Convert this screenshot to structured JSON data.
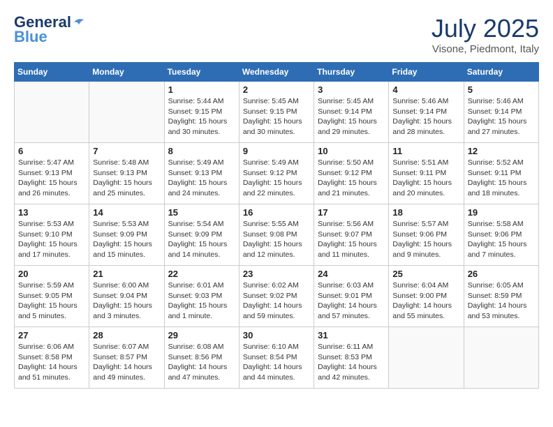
{
  "header": {
    "logo_line1": "General",
    "logo_line2": "Blue",
    "month_title": "July 2025",
    "location": "Visone, Piedmont, Italy"
  },
  "weekdays": [
    "Sunday",
    "Monday",
    "Tuesday",
    "Wednesday",
    "Thursday",
    "Friday",
    "Saturday"
  ],
  "weeks": [
    [
      {
        "day": "",
        "info": ""
      },
      {
        "day": "",
        "info": ""
      },
      {
        "day": "1",
        "info": "Sunrise: 5:44 AM\nSunset: 9:15 PM\nDaylight: 15 hours\nand 30 minutes."
      },
      {
        "day": "2",
        "info": "Sunrise: 5:45 AM\nSunset: 9:15 PM\nDaylight: 15 hours\nand 30 minutes."
      },
      {
        "day": "3",
        "info": "Sunrise: 5:45 AM\nSunset: 9:14 PM\nDaylight: 15 hours\nand 29 minutes."
      },
      {
        "day": "4",
        "info": "Sunrise: 5:46 AM\nSunset: 9:14 PM\nDaylight: 15 hours\nand 28 minutes."
      },
      {
        "day": "5",
        "info": "Sunrise: 5:46 AM\nSunset: 9:14 PM\nDaylight: 15 hours\nand 27 minutes."
      }
    ],
    [
      {
        "day": "6",
        "info": "Sunrise: 5:47 AM\nSunset: 9:13 PM\nDaylight: 15 hours\nand 26 minutes."
      },
      {
        "day": "7",
        "info": "Sunrise: 5:48 AM\nSunset: 9:13 PM\nDaylight: 15 hours\nand 25 minutes."
      },
      {
        "day": "8",
        "info": "Sunrise: 5:49 AM\nSunset: 9:13 PM\nDaylight: 15 hours\nand 24 minutes."
      },
      {
        "day": "9",
        "info": "Sunrise: 5:49 AM\nSunset: 9:12 PM\nDaylight: 15 hours\nand 22 minutes."
      },
      {
        "day": "10",
        "info": "Sunrise: 5:50 AM\nSunset: 9:12 PM\nDaylight: 15 hours\nand 21 minutes."
      },
      {
        "day": "11",
        "info": "Sunrise: 5:51 AM\nSunset: 9:11 PM\nDaylight: 15 hours\nand 20 minutes."
      },
      {
        "day": "12",
        "info": "Sunrise: 5:52 AM\nSunset: 9:11 PM\nDaylight: 15 hours\nand 18 minutes."
      }
    ],
    [
      {
        "day": "13",
        "info": "Sunrise: 5:53 AM\nSunset: 9:10 PM\nDaylight: 15 hours\nand 17 minutes."
      },
      {
        "day": "14",
        "info": "Sunrise: 5:53 AM\nSunset: 9:09 PM\nDaylight: 15 hours\nand 15 minutes."
      },
      {
        "day": "15",
        "info": "Sunrise: 5:54 AM\nSunset: 9:09 PM\nDaylight: 15 hours\nand 14 minutes."
      },
      {
        "day": "16",
        "info": "Sunrise: 5:55 AM\nSunset: 9:08 PM\nDaylight: 15 hours\nand 12 minutes."
      },
      {
        "day": "17",
        "info": "Sunrise: 5:56 AM\nSunset: 9:07 PM\nDaylight: 15 hours\nand 11 minutes."
      },
      {
        "day": "18",
        "info": "Sunrise: 5:57 AM\nSunset: 9:06 PM\nDaylight: 15 hours\nand 9 minutes."
      },
      {
        "day": "19",
        "info": "Sunrise: 5:58 AM\nSunset: 9:06 PM\nDaylight: 15 hours\nand 7 minutes."
      }
    ],
    [
      {
        "day": "20",
        "info": "Sunrise: 5:59 AM\nSunset: 9:05 PM\nDaylight: 15 hours\nand 5 minutes."
      },
      {
        "day": "21",
        "info": "Sunrise: 6:00 AM\nSunset: 9:04 PM\nDaylight: 15 hours\nand 3 minutes."
      },
      {
        "day": "22",
        "info": "Sunrise: 6:01 AM\nSunset: 9:03 PM\nDaylight: 15 hours\nand 1 minute."
      },
      {
        "day": "23",
        "info": "Sunrise: 6:02 AM\nSunset: 9:02 PM\nDaylight: 14 hours\nand 59 minutes."
      },
      {
        "day": "24",
        "info": "Sunrise: 6:03 AM\nSunset: 9:01 PM\nDaylight: 14 hours\nand 57 minutes."
      },
      {
        "day": "25",
        "info": "Sunrise: 6:04 AM\nSunset: 9:00 PM\nDaylight: 14 hours\nand 55 minutes."
      },
      {
        "day": "26",
        "info": "Sunrise: 6:05 AM\nSunset: 8:59 PM\nDaylight: 14 hours\nand 53 minutes."
      }
    ],
    [
      {
        "day": "27",
        "info": "Sunrise: 6:06 AM\nSunset: 8:58 PM\nDaylight: 14 hours\nand 51 minutes."
      },
      {
        "day": "28",
        "info": "Sunrise: 6:07 AM\nSunset: 8:57 PM\nDaylight: 14 hours\nand 49 minutes."
      },
      {
        "day": "29",
        "info": "Sunrise: 6:08 AM\nSunset: 8:56 PM\nDaylight: 14 hours\nand 47 minutes."
      },
      {
        "day": "30",
        "info": "Sunrise: 6:10 AM\nSunset: 8:54 PM\nDaylight: 14 hours\nand 44 minutes."
      },
      {
        "day": "31",
        "info": "Sunrise: 6:11 AM\nSunset: 8:53 PM\nDaylight: 14 hours\nand 42 minutes."
      },
      {
        "day": "",
        "info": ""
      },
      {
        "day": "",
        "info": ""
      }
    ]
  ]
}
